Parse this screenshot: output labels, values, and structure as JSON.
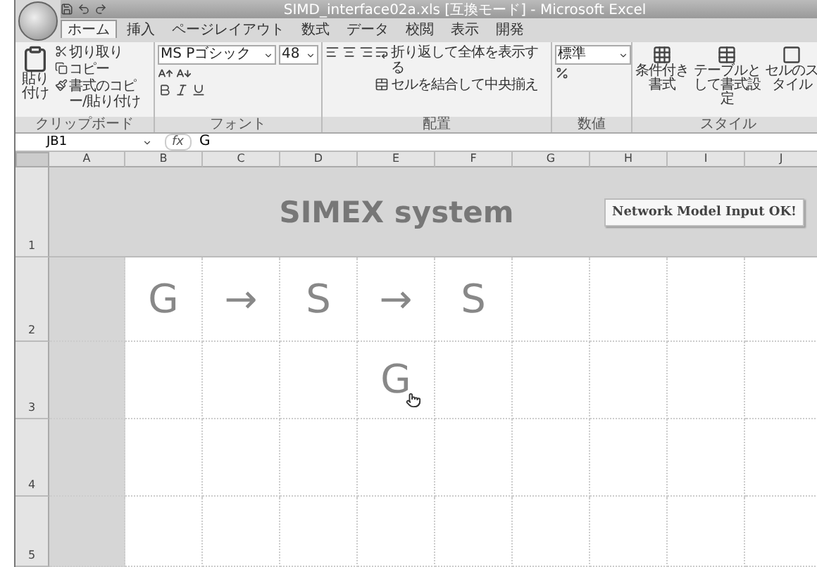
{
  "window": {
    "title": "SIMD_interface02a.xls [互換モード] - Microsoft Excel"
  },
  "ribbon": {
    "tabs": [
      {
        "label": "ホーム",
        "selected": true
      },
      {
        "label": "挿入",
        "selected": false
      },
      {
        "label": "ページレイアウト",
        "selected": false
      },
      {
        "label": "数式",
        "selected": false
      },
      {
        "label": "データ",
        "selected": false
      },
      {
        "label": "校閲",
        "selected": false
      },
      {
        "label": "表示",
        "selected": false
      },
      {
        "label": "開発",
        "selected": false
      }
    ],
    "clipboard": {
      "name": "クリップボード",
      "paste": "貼り付け",
      "items": [
        {
          "kind": "cut",
          "label": "切り取り"
        },
        {
          "kind": "copy",
          "label": "コピー"
        },
        {
          "kind": "painter",
          "label": "書式のコピー/貼り付け"
        }
      ]
    },
    "font": {
      "name": "フォント",
      "font_name": "MS Pゴシック",
      "font_size": "48"
    },
    "alignment": {
      "name": "配置",
      "wrap": "折り返して全体を表示する",
      "merge": "セルを結合して中央揃え"
    },
    "number": {
      "name": "数値",
      "format": "標準"
    },
    "styles": {
      "name": "スタイル",
      "buttons": [
        {
          "kind": "conditional",
          "label": "条件付き書式"
        },
        {
          "kind": "table",
          "label": "テーブルとして書式設定"
        },
        {
          "kind": "cell",
          "label": "セルのスタイル"
        }
      ]
    }
  },
  "formula_bar": {
    "name_box": "JB1",
    "fx": "fx",
    "content": "G"
  },
  "sheet": {
    "columns": [
      "A",
      "B",
      "C",
      "D",
      "E",
      "F",
      "G",
      "H",
      "I",
      "J"
    ],
    "rows": [
      {
        "header": "1",
        "kind": "banner",
        "title": "SIMEX system",
        "button": "Network Model Input OK!"
      },
      {
        "header": "2",
        "kind": "cells",
        "cells": {
          "B": {
            "text": "G",
            "hovered": false
          },
          "C": {
            "text": "→",
            "hovered": false
          },
          "D": {
            "text": "S",
            "hovered": false
          },
          "E": {
            "text": "→",
            "hovered": false
          },
          "F": {
            "text": "S",
            "hovered": false
          }
        }
      },
      {
        "header": "3",
        "kind": "cells",
        "cells": {
          "E": {
            "text": "G",
            "hovered": true
          }
        }
      },
      {
        "header": "4",
        "kind": "cells"
      },
      {
        "header": "5",
        "kind": "cells"
      }
    ]
  }
}
